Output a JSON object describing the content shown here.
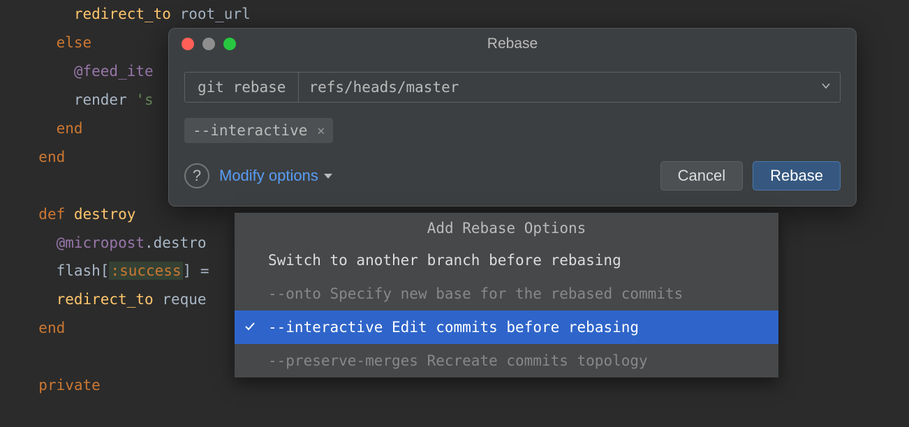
{
  "editor": {
    "lines": [
      {
        "indent": 3,
        "tokens": [
          {
            "cls": "method",
            "t": "redirect_to"
          },
          {
            "cls": "ident",
            "t": " root_url"
          }
        ]
      },
      {
        "indent": 2,
        "tokens": [
          {
            "cls": "kw",
            "t": "else"
          }
        ]
      },
      {
        "indent": 3,
        "tokens": [
          {
            "cls": "ivar",
            "t": "@feed_ite"
          }
        ]
      },
      {
        "indent": 3,
        "tokens": [
          {
            "cls": "ident",
            "t": "render "
          },
          {
            "cls": "str",
            "t": "'s"
          }
        ]
      },
      {
        "indent": 2,
        "tokens": [
          {
            "cls": "kw",
            "t": "end"
          }
        ]
      },
      {
        "indent": 1,
        "tokens": [
          {
            "cls": "kw",
            "t": "end"
          }
        ]
      },
      {
        "indent": 0,
        "tokens": []
      },
      {
        "indent": 1,
        "tokens": [
          {
            "cls": "kw",
            "t": "def "
          },
          {
            "cls": "method",
            "t": "destroy"
          }
        ]
      },
      {
        "indent": 2,
        "tokens": [
          {
            "cls": "ivar",
            "t": "@micropost"
          },
          {
            "cls": "ident",
            "t": ".destro"
          }
        ]
      },
      {
        "indent": 2,
        "tokens": [
          {
            "cls": "ident",
            "t": "flash["
          },
          {
            "cls": "sym-hl",
            "t": ":success"
          },
          {
            "cls": "ident",
            "t": "] ="
          }
        ]
      },
      {
        "indent": 2,
        "tokens": [
          {
            "cls": "method",
            "t": "redirect_to"
          },
          {
            "cls": "ident",
            "t": " reque"
          }
        ]
      },
      {
        "indent": 1,
        "tokens": [
          {
            "cls": "kw",
            "t": "end"
          }
        ]
      },
      {
        "indent": 0,
        "tokens": []
      },
      {
        "indent": 1,
        "tokens": [
          {
            "cls": "kw",
            "t": "private"
          }
        ]
      }
    ]
  },
  "dialog": {
    "title": "Rebase",
    "command_prefix": "git rebase",
    "target": "refs/heads/master",
    "chip_label": "--interactive",
    "modify_label": "Modify options",
    "cancel_label": "Cancel",
    "confirm_label": "Rebase"
  },
  "dropdown": {
    "header": "Add Rebase Options",
    "items": [
      {
        "flag": "",
        "text": "Switch to another branch before rebasing",
        "desc": "",
        "selected": false
      },
      {
        "flag": "--onto",
        "text": "",
        "desc": "Specify new base for the rebased commits",
        "selected": false
      },
      {
        "flag": "--interactive",
        "text": "",
        "desc": "Edit commits before rebasing",
        "selected": true
      },
      {
        "flag": "--preserve-merges",
        "text": "",
        "desc": "Recreate commits topology",
        "selected": false
      }
    ]
  }
}
